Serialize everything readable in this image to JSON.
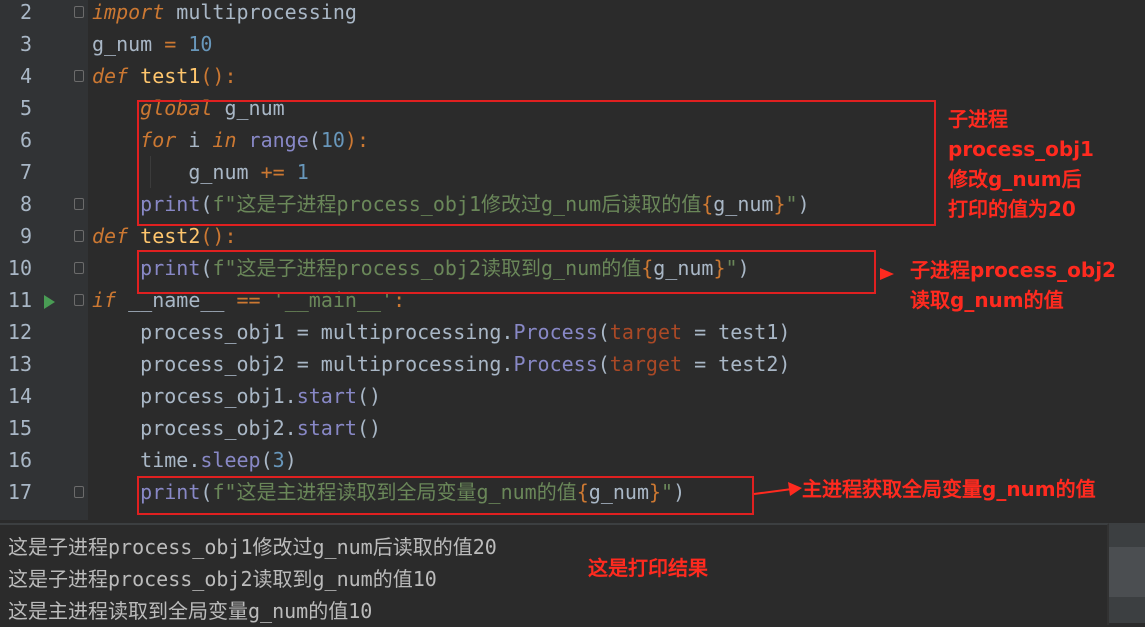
{
  "editor": {
    "line_numbers": [
      "2",
      "3",
      "4",
      "5",
      "6",
      "7",
      "8",
      "9",
      "10",
      "11",
      "12",
      "13",
      "14",
      "15",
      "16",
      "17"
    ],
    "tokens": {
      "l2_import": "import",
      "l2_rest": " multiprocessing",
      "l3_a": "g_num ",
      "l3_eq": "=",
      "l3_num": "10",
      "l4_def": "def",
      "l4_name": "test1",
      "l4_rest": "():",
      "l5_global": "global",
      "l5_rest": " g_num",
      "l6_for": "for",
      "l6_i": " i ",
      "l6_in": "in",
      "l6_range": " range",
      "l6_open": "(",
      "l6_num": "10",
      "l6_close": "):",
      "l7_a": "g_num ",
      "l7_op": "+=",
      "l7_num": "1",
      "l8_print": "print",
      "l8_open": "(",
      "l8_str_a": "f\"这是子进程process_obj1修改过g_num后读取的值",
      "l8_lb": "{",
      "l8_var": "g_num",
      "l8_rb": "}",
      "l8_str_b": "\"",
      "l8_close": ")",
      "l9_def": "def",
      "l9_name": "test2",
      "l9_rest": "():",
      "l10_print": "print",
      "l10_open": "(",
      "l10_str_a": "f\"这是子进程process_obj2读取到g_num的值",
      "l10_lb": "{",
      "l10_var": "g_num",
      "l10_rb": "}",
      "l10_str_b": "\"",
      "l10_close": ")",
      "l11_if": "if",
      "l11_name": " __name__ ",
      "l11_eq": "==",
      "l11_str": " '__main__'",
      "l11_colon": ":",
      "l12_a": "process_obj1 = multiprocessing.",
      "l12_cls": "Process",
      "l12_open": "(",
      "l12_param": "target",
      "l12_b": " = test1)",
      "l13_a": "process_obj2 = multiprocessing.",
      "l13_cls": "Process",
      "l13_open": "(",
      "l13_param": "target",
      "l13_b": " = test2)",
      "l14_a": "process_obj1.",
      "l14_meth": "start",
      "l14_b": "()",
      "l15_a": "process_obj2.",
      "l15_meth": "start",
      "l15_b": "()",
      "l16_a": "time.",
      "l16_meth": "sleep",
      "l16_open": "(",
      "l16_num": "3",
      "l16_close": ")",
      "l17_print": "print",
      "l17_open": "(",
      "l17_str_a": "f\"这是主进程读取到全局变量g_num的值",
      "l17_lb": "{",
      "l17_var": "g_num",
      "l17_rb": "}",
      "l17_str_b": "\"",
      "l17_close": ")"
    }
  },
  "annotations": {
    "note1": "子进程\nprocess_obj1\n修改g_num后\n打印的值为20",
    "note2": "子进程process_obj2\n读取g_num的值",
    "note3": "主进程获取全局变量g_num的值",
    "note4": "这是打印结果"
  },
  "console": {
    "lines": [
      "这是子进程process_obj1修改过g_num后读取的值20",
      "这是子进程process_obj2读取到g_num的值10",
      "这是主进程读取到全局变量g_num的值10"
    ]
  },
  "colors": {
    "background": "#2b2b2b",
    "keyword": "#cc7832",
    "number": "#6897bb",
    "string": "#6a8759",
    "function": "#ffc66d",
    "annotation": "#ff2a1f"
  }
}
